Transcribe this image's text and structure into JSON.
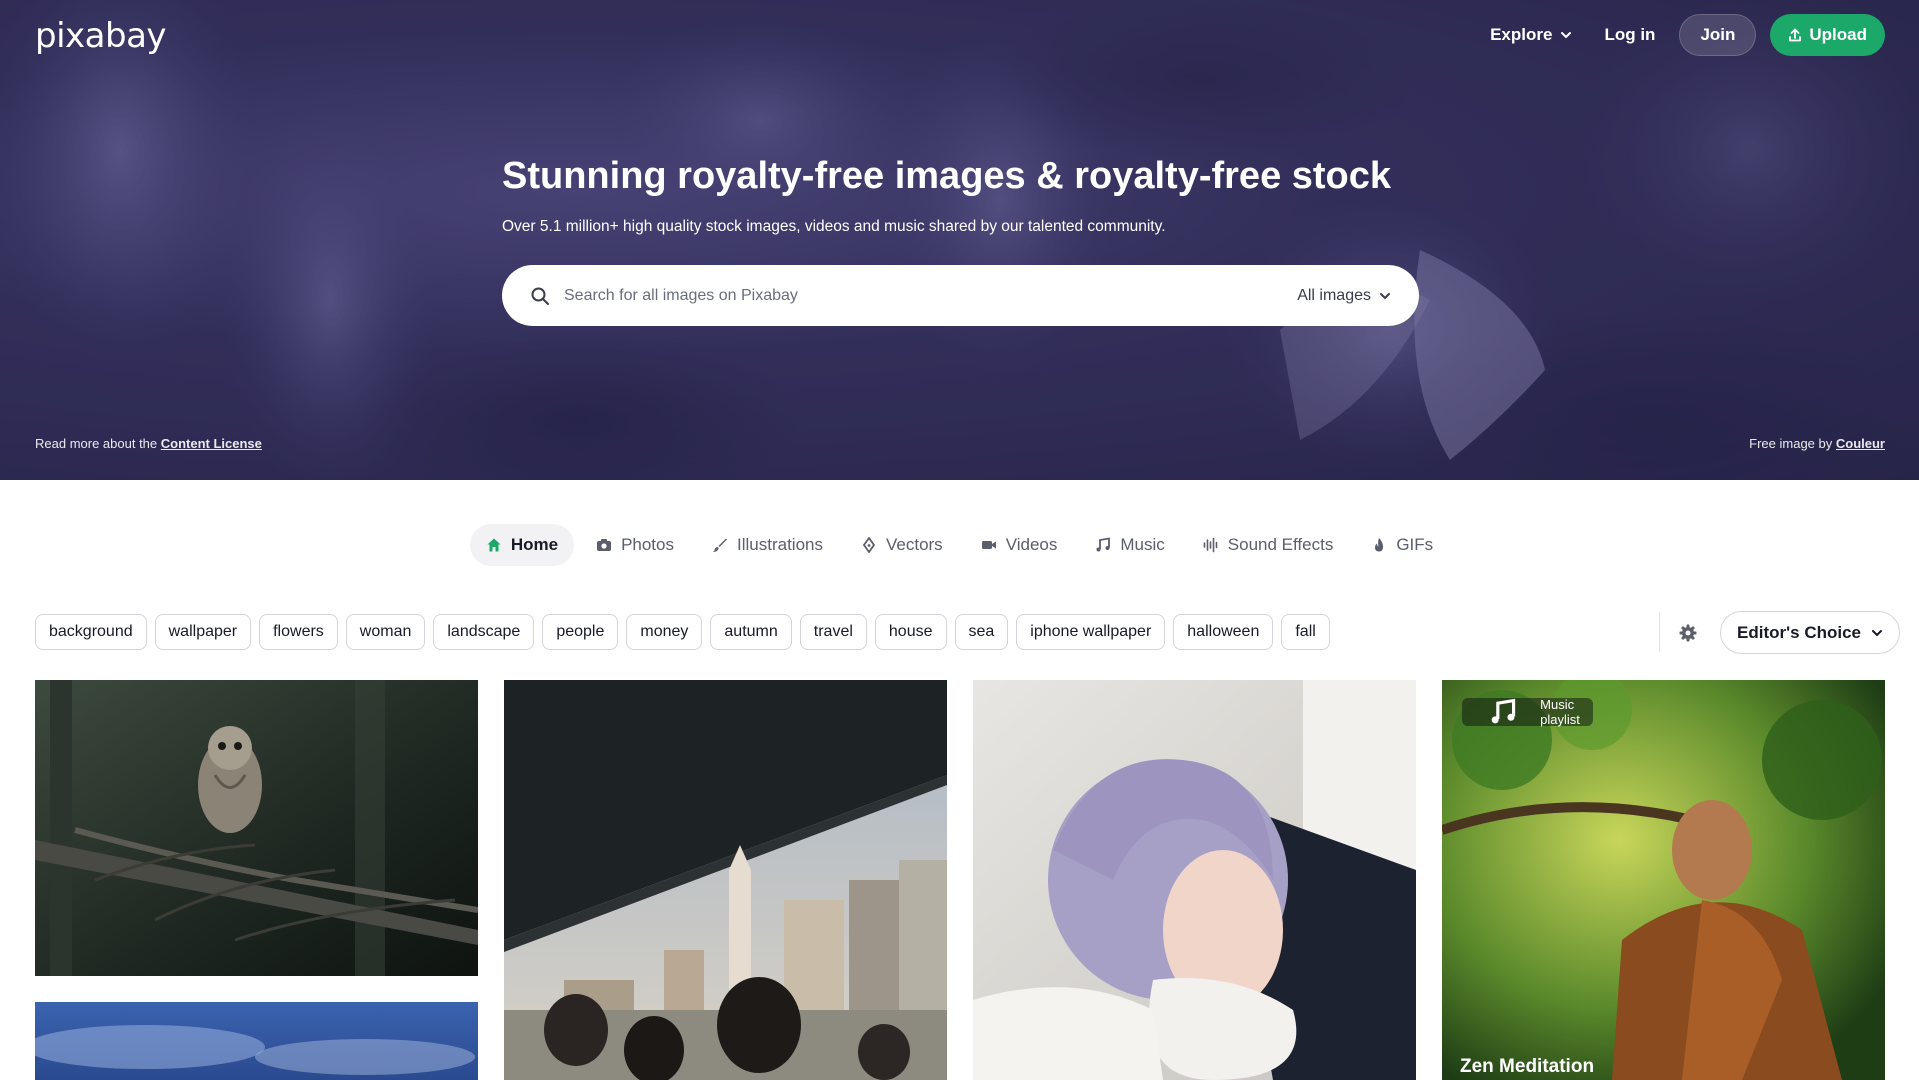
{
  "brand": {
    "logo": "pixabay"
  },
  "nav": {
    "explore": "Explore",
    "login": "Log in",
    "join": "Join",
    "upload": "Upload"
  },
  "hero": {
    "title": "Stunning royalty-free images & royalty-free stock",
    "subtitle": "Over 5.1 million+ high quality stock images, videos and music shared by our talented community.",
    "search_placeholder": "Search for all images on Pixabay",
    "search_filter": "All images",
    "license_prefix": "Read more about the",
    "license_link": "Content License",
    "credit_prefix": "Free image by",
    "credit_author": "Couleur"
  },
  "tabs": [
    {
      "label": "Home",
      "icon": "home-icon",
      "active": true
    },
    {
      "label": "Photos",
      "icon": "camera-icon"
    },
    {
      "label": "Illustrations",
      "icon": "brush-icon"
    },
    {
      "label": "Vectors",
      "icon": "pen-nib-icon"
    },
    {
      "label": "Videos",
      "icon": "video-icon"
    },
    {
      "label": "Music",
      "icon": "music-note-icon"
    },
    {
      "label": "Sound Effects",
      "icon": "waveform-icon"
    },
    {
      "label": "GIFs",
      "icon": "flame-icon"
    }
  ],
  "tags": [
    "background",
    "wallpaper",
    "flowers",
    "woman",
    "landscape",
    "people",
    "money",
    "autumn",
    "travel",
    "house",
    "sea",
    "iphone wallpaper",
    "halloween",
    "fall"
  ],
  "sort": {
    "label": "Editor's Choice"
  },
  "grid": {
    "playlist_badge": "Music playlist",
    "playlist_title": "Zen Meditation"
  },
  "colors": {
    "accent": "#1ca868",
    "hero": "#3e3a6b"
  }
}
